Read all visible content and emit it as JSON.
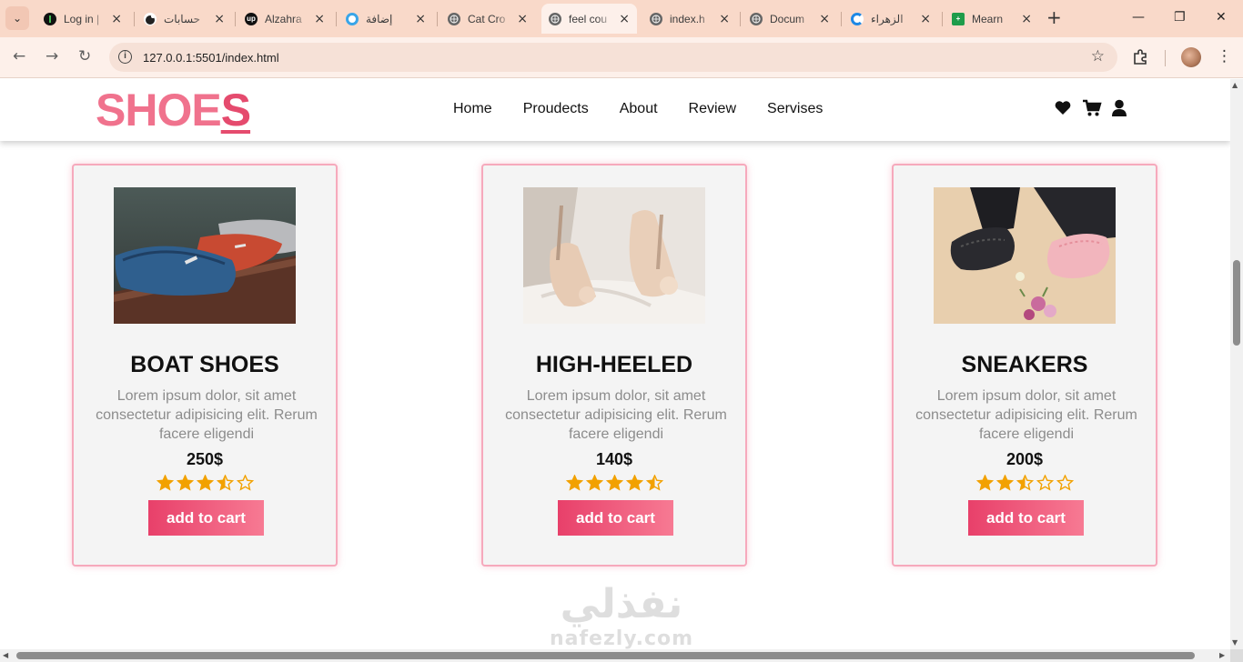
{
  "browser": {
    "tabs": [
      {
        "title": "Log in |",
        "favicon": "github-icon",
        "active": false
      },
      {
        "title": "حسابات",
        "favicon": "circle-logo-icon",
        "active": false
      },
      {
        "title": "Alzahra",
        "favicon": "upwork-icon",
        "active": false
      },
      {
        "title": "إضافة",
        "favicon": "blue-ring-icon",
        "active": false
      },
      {
        "title": "Cat Cro",
        "favicon": "globe-icon",
        "active": false
      },
      {
        "title": "feel cou",
        "favicon": "globe-icon",
        "active": true
      },
      {
        "title": "index.h",
        "favicon": "globe-icon",
        "active": false
      },
      {
        "title": "Docum",
        "favicon": "globe-icon",
        "active": false
      },
      {
        "title": "الزهراء",
        "favicon": "blue-swirl-icon",
        "active": false
      },
      {
        "title": "Mearn",
        "favicon": "green-plus-icon",
        "active": false
      }
    ],
    "url": "127.0.0.1:5501/index.html"
  },
  "site": {
    "logo_main": "SHOE",
    "logo_last": "S",
    "nav": [
      "Home",
      "Proudects",
      "About",
      "Review",
      "Servises"
    ],
    "header_icons": [
      "heart-icon",
      "cart-icon",
      "user-icon"
    ],
    "accent_color": "#f0728d",
    "button_color": "#e8406a",
    "star_color": "#f2a100"
  },
  "products": [
    {
      "name": "BOAT SHOES",
      "desc": "Lorem ipsum dolor, sit amet consectetur adipisicing elit. Rerum facere eligendi",
      "price": "250$",
      "rating": 3.5,
      "button": "add to cart"
    },
    {
      "name": "HIGH-HEELED",
      "desc": "Lorem ipsum dolor, sit amet consectetur adipisicing elit. Rerum facere eligendi",
      "price": "140$",
      "rating": 4.5,
      "button": "add to cart"
    },
    {
      "name": "SNEAKERS",
      "desc": "Lorem ipsum dolor, sit amet consectetur adipisicing elit. Rerum facere eligendi",
      "price": "200$",
      "rating": 2.5,
      "button": "add to cart"
    }
  ],
  "watermark": {
    "arabic": "نفذلي",
    "latin": "nafezly.com"
  }
}
